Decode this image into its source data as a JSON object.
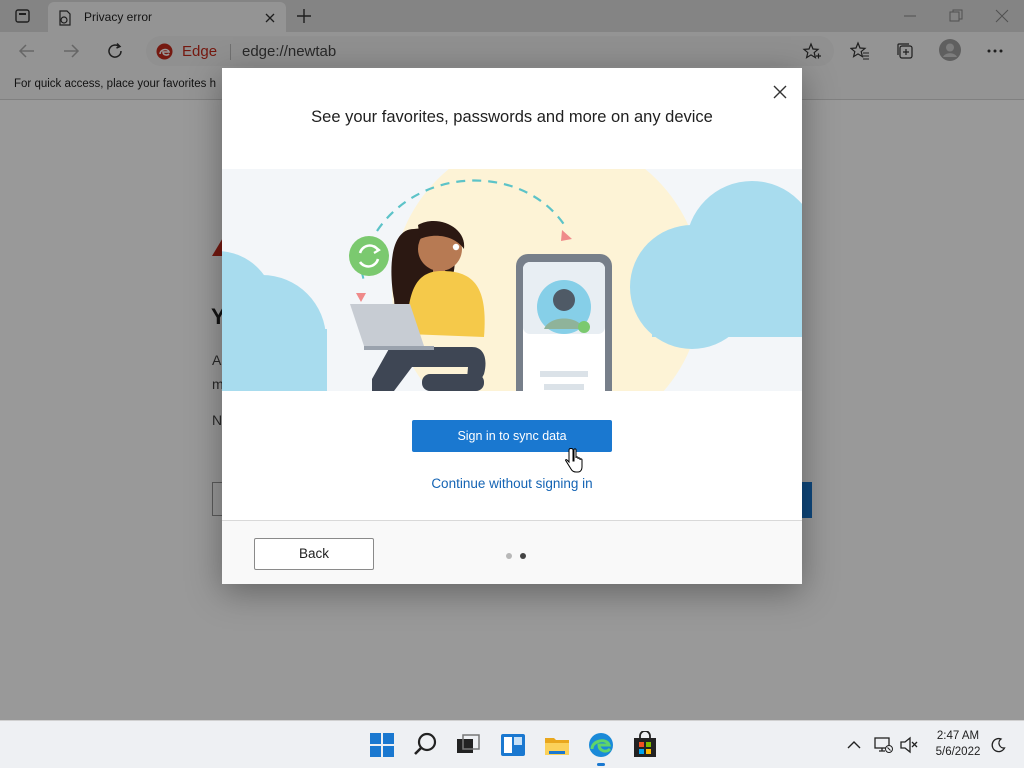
{
  "browser": {
    "tab_title": "Privacy error",
    "brand": "Edge",
    "address": "edge://newtab",
    "favorites_bar_text": "For quick access, place your favorites h"
  },
  "page_behind": {
    "fragments": [
      "Y",
      "A",
      "m",
      "N"
    ]
  },
  "dialog": {
    "title": "See your favorites, passwords and more on any device",
    "signin_label": "Sign in to sync data",
    "continue_label": "Continue without signing in",
    "back_label": "Back",
    "steps": {
      "total": 2,
      "current": 2
    }
  },
  "taskbar": {
    "time": "2:47 AM",
    "date": "5/6/2022",
    "icons": [
      "windows-start-icon",
      "search-icon",
      "task-view-icon",
      "widgets-icon",
      "file-explorer-icon",
      "edge-icon",
      "store-icon"
    ]
  },
  "colors": {
    "accent": "#1a78d0",
    "link": "#1464b4",
    "edge_brand": "#c42b1c"
  }
}
